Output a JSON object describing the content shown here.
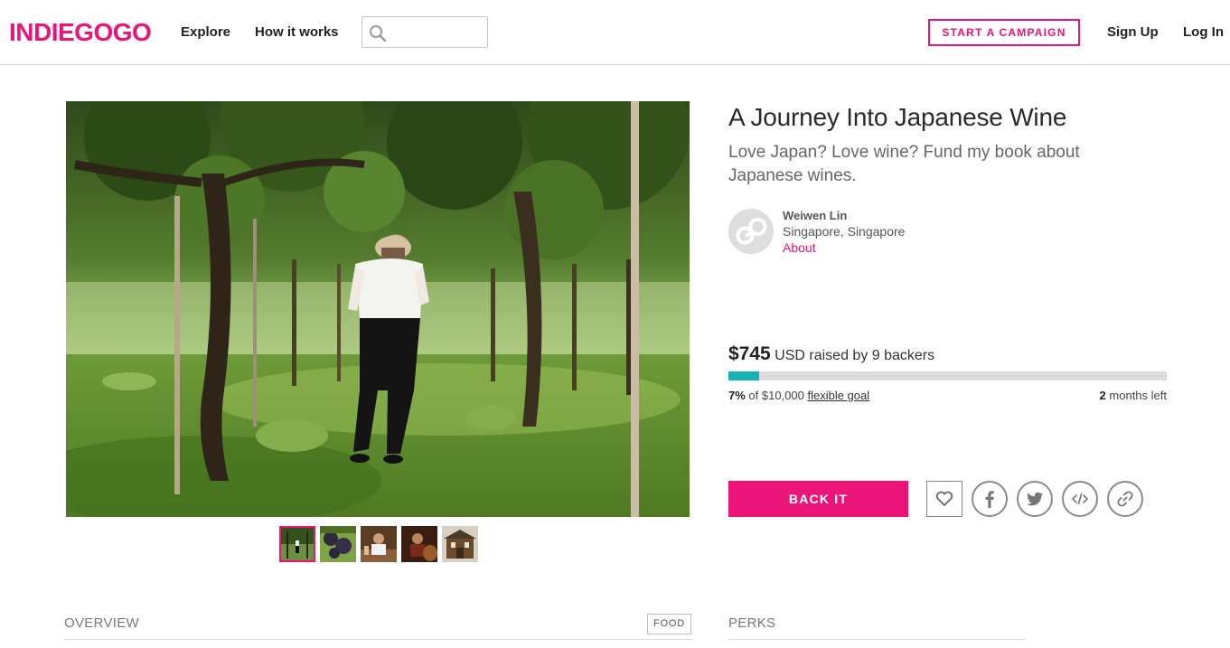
{
  "header": {
    "logo": "INDIEGOGO",
    "nav": {
      "explore": "Explore",
      "how_it_works": "How it works"
    },
    "search": {
      "placeholder": "",
      "icon": "search-icon"
    },
    "start_campaign": "START A CAMPAIGN",
    "sign_up": "Sign Up",
    "log_in": "Log In"
  },
  "campaign": {
    "title": "A Journey Into Japanese Wine",
    "tagline": "Love Japan? Love wine? Fund my book about Japanese wines.",
    "owner": {
      "name": "Weiwen Lin",
      "location": "Singapore, Singapore",
      "about_label": "About",
      "avatar_icon": "go-placeholder-avatar"
    },
    "funding": {
      "amount": "$745",
      "raised_text": "USD raised by 9 backers",
      "percent_text": "7%",
      "goal_text": "of $10,000",
      "goal_type": "flexible goal",
      "progress_fraction": 0.07,
      "time_number": "2",
      "time_unit": "months left"
    },
    "back_it": "BACK IT",
    "share_icons": [
      "heart-icon",
      "facebook-icon",
      "twitter-icon",
      "embed-icon",
      "link-icon"
    ],
    "thumbnails": [
      {
        "subject": "man walking in vineyard",
        "active": true
      },
      {
        "subject": "grape clusters on vine",
        "active": false
      },
      {
        "subject": "winemaker at table",
        "active": false
      },
      {
        "subject": "person in cellar",
        "active": false
      },
      {
        "subject": "traditional wooden building",
        "active": false
      }
    ]
  },
  "tabs": {
    "overview": "OVERVIEW",
    "category": "FOOD",
    "perks": "PERKS"
  },
  "colors": {
    "brand_pink": "#eb1478",
    "progress_teal": "#1bb1b4",
    "progress_track": "#dcdcdc"
  }
}
